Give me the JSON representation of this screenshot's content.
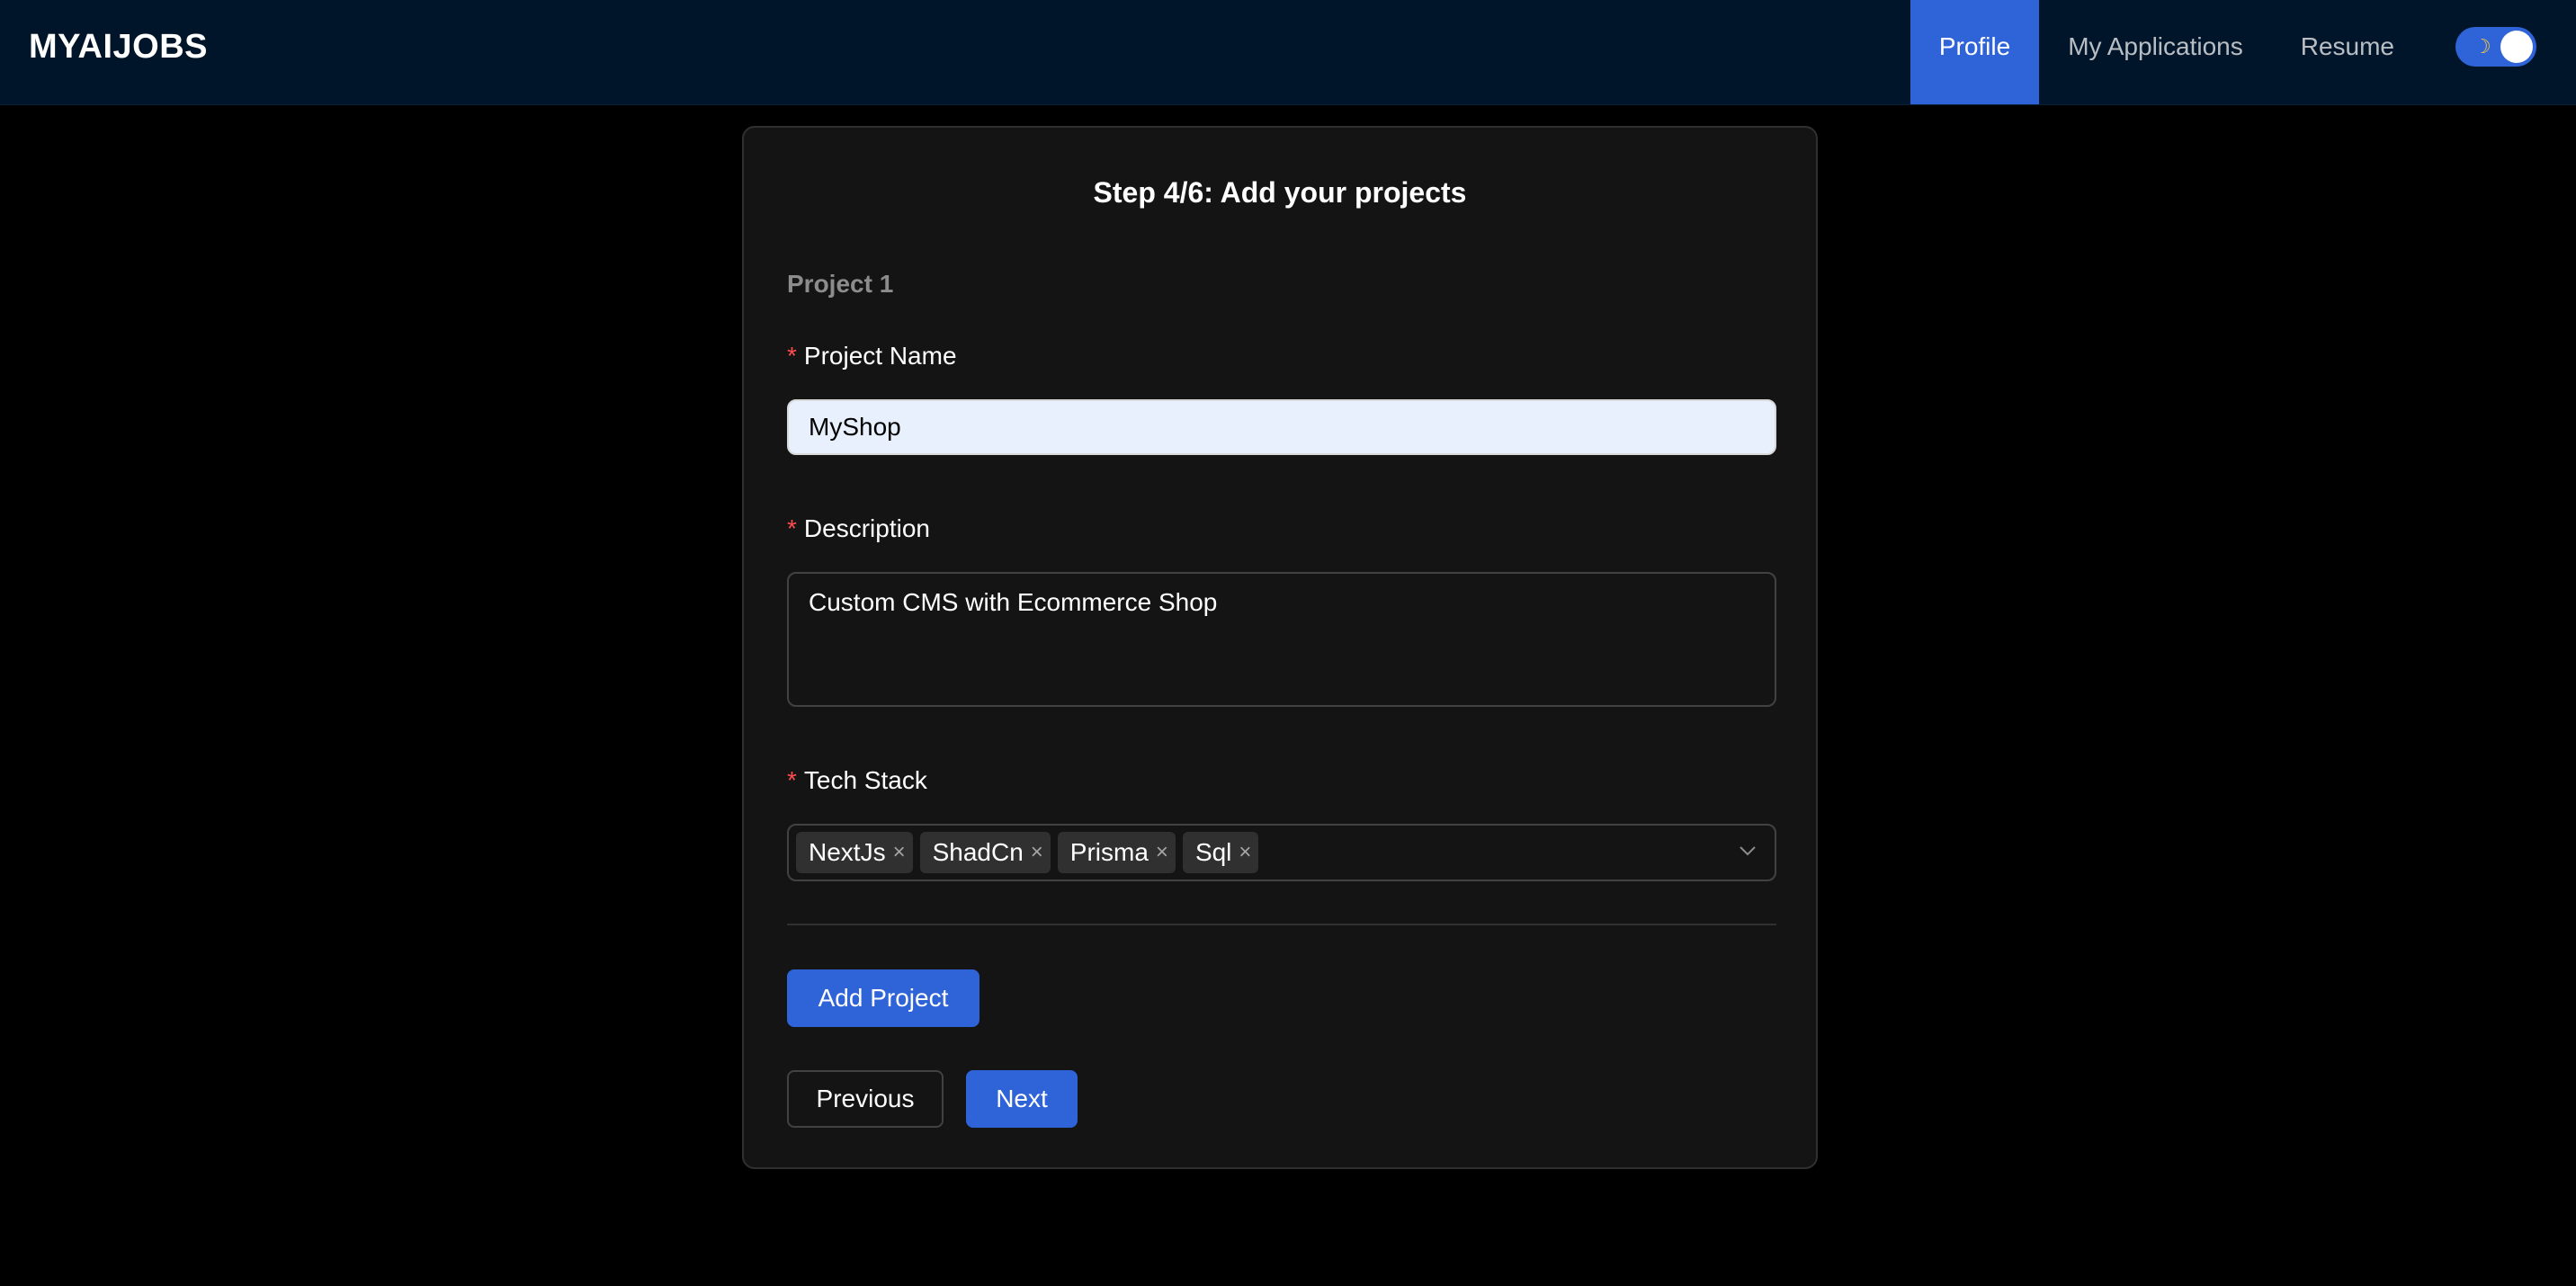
{
  "header": {
    "logo": "MYAIJOBS",
    "nav": [
      {
        "label": "Profile",
        "active": true
      },
      {
        "label": "My Applications",
        "active": false
      },
      {
        "label": "Resume",
        "active": false
      }
    ],
    "theme_toggle": {
      "icon": "moon-icon",
      "on": true
    }
  },
  "form": {
    "step_title": "Step 4/6: Add your projects",
    "project_heading": "Project 1",
    "required_mark": "*",
    "project_name": {
      "label": "Project Name",
      "value": "MyShop"
    },
    "description": {
      "label": "Description",
      "value": "Custom CMS with Ecommerce Shop"
    },
    "tech_stack": {
      "label": "Tech Stack",
      "tags": [
        "NextJs",
        "ShadCn",
        "Prisma",
        "Sql"
      ],
      "remove_glyph": "×"
    },
    "add_project_label": "Add Project",
    "previous_label": "Previous",
    "next_label": "Next"
  },
  "colors": {
    "primary": "#2f64d8",
    "header_bg": "#001529",
    "card_bg": "#141414",
    "required": "#ff4d4f"
  }
}
